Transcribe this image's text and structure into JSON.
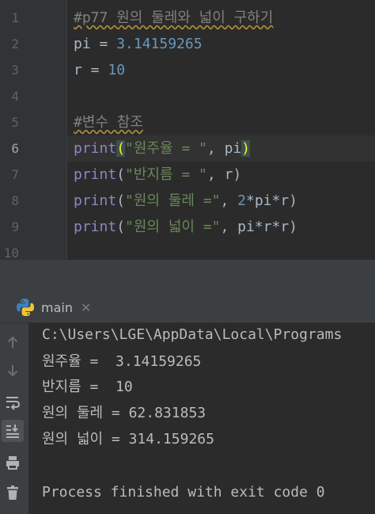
{
  "editor": {
    "line_numbers": [
      "1",
      "2",
      "3",
      "4",
      "5",
      "6",
      "7",
      "8",
      "9",
      "10"
    ],
    "lines": [
      {
        "comment": "#p77 원의 둘레와 넓이 구하기"
      },
      {
        "var": "pi",
        "op": " = ",
        "num": "3.14159265"
      },
      {
        "var": "r",
        "op": " = ",
        "num": "10"
      },
      {},
      {
        "comment": "#변수 참조"
      },
      {
        "func": "print",
        "open": "(",
        "str": "\"원주율 = \"",
        "rest": ", pi",
        "close": ")"
      },
      {
        "func": "print",
        "open": "(",
        "str": "\"반지름 = \"",
        "rest": ", r)"
      },
      {
        "func": "print",
        "open": "(",
        "str": "\"원의 둘레 =\"",
        "sep": ", ",
        "num": "2",
        "rest": "*pi*r)"
      },
      {
        "func": "print",
        "open": "(",
        "str": "\"원의 넓이 =\"",
        "rest": ", pi*r*r)"
      },
      {}
    ]
  },
  "run_panel": {
    "tab_label": "main",
    "tab_icon": "python-icon",
    "close_icon": "close-icon",
    "toolbar_icons": [
      "up-arrow-icon",
      "down-arrow-icon",
      "soft-wrap-icon",
      "scroll-to-end-icon",
      "print-icon",
      "trash-icon"
    ]
  },
  "console": {
    "lines": [
      "C:\\Users\\LGE\\AppData\\Local\\Programs",
      "원주율 =  3.14159265",
      "반지름 =  10",
      "원의 둘레 = 62.831853",
      "원의 넓이 = 314.159265",
      "",
      "Process finished with exit code 0"
    ]
  },
  "colors": {
    "background": "#2b2b2b",
    "gutter": "#313335",
    "panel": "#3c3f41",
    "keyword": "#8888c6",
    "string": "#6a8759",
    "number": "#6897bb",
    "comment": "#808080",
    "default_text": "#a9b7c6",
    "console_text": "#bbbbbb"
  }
}
